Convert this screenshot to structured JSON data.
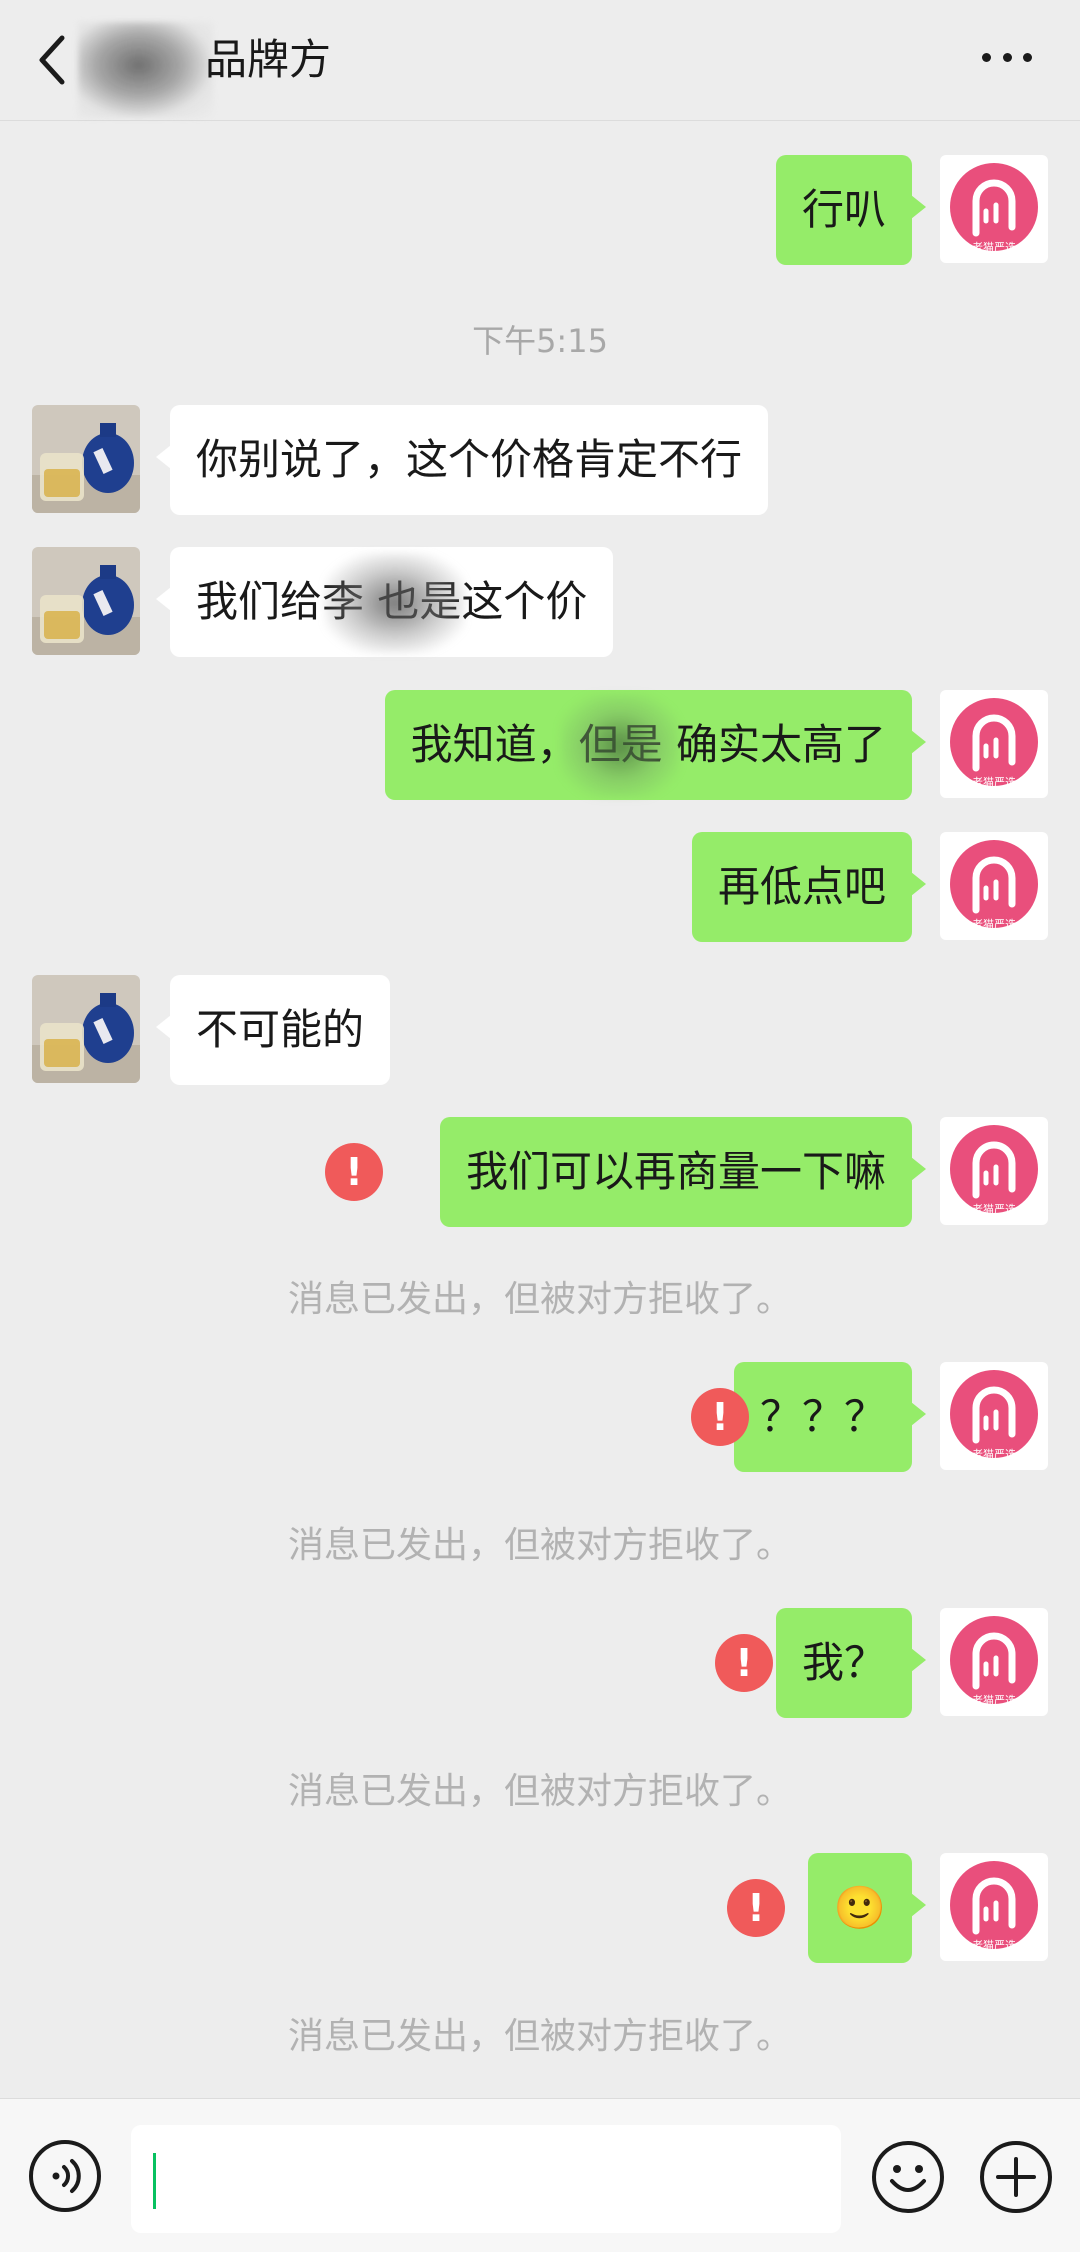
{
  "header": {
    "title": "品牌方",
    "back_icon": "chevron-left-icon",
    "more_icon": "more-dots-icon"
  },
  "colors": {
    "outgoing_bubble": "#95ec69",
    "incoming_bubble": "#ffffff",
    "error": "#f05a5a",
    "accent": "#07c160",
    "brand_avatar": "#e94f7c"
  },
  "avatar_brand_text": "老猫严选",
  "timestamp": "下午5:15",
  "messages": [
    {
      "side": "out",
      "text": "行叭"
    },
    {
      "side": "in",
      "text": "你别说了，这个价格肯定不行"
    },
    {
      "side": "in",
      "text": "我们给李 也是这个价"
    },
    {
      "side": "out",
      "text": "我知道，但是 确实太高了"
    },
    {
      "side": "out",
      "text": "再低点吧"
    },
    {
      "side": "in",
      "text": "不可能的"
    },
    {
      "side": "out",
      "text": "我们可以再商量一下嘛",
      "failed": true
    },
    {
      "side": "out",
      "text": "？？？",
      "failed": true
    },
    {
      "side": "out",
      "text": "我？",
      "failed": true
    },
    {
      "side": "out",
      "text": "🙂",
      "failed": true
    }
  ],
  "error_mark": "!",
  "rejected_notice": "消息已发出，但被对方拒收了。",
  "composer": {
    "voice_icon": "voice-icon",
    "emoji_icon": "emoji-icon",
    "plus_icon": "plus-circle-icon",
    "value": ""
  }
}
